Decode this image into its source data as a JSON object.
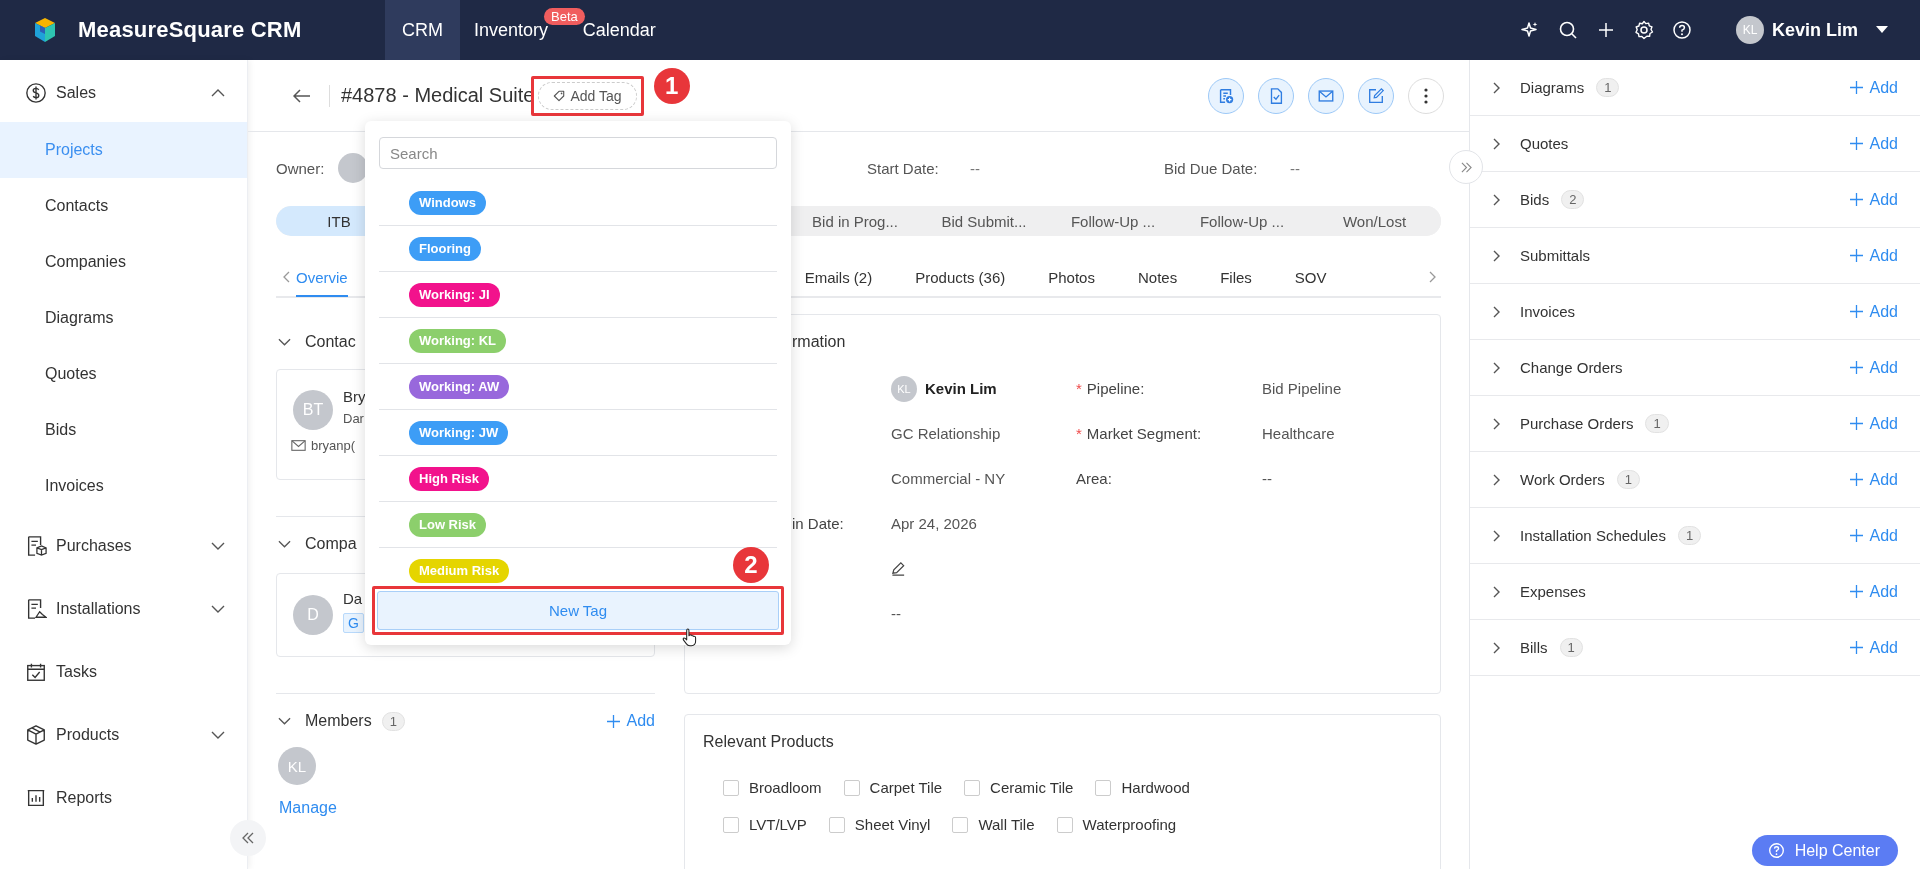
{
  "app": {
    "title": "MeasureSquare CRM"
  },
  "top_nav": [
    {
      "label": "CRM",
      "selected": true
    },
    {
      "label": "Inventory",
      "selected": false,
      "badge": "Beta"
    },
    {
      "label": "Calendar",
      "selected": false
    }
  ],
  "user": {
    "initials": "KL",
    "name": "Kevin Lim"
  },
  "sidebar": {
    "items": [
      {
        "label": "Sales",
        "kind": "group",
        "expanded": true,
        "children": [
          {
            "label": "Projects",
            "selected": true
          },
          {
            "label": "Contacts",
            "selected": false
          },
          {
            "label": "Companies",
            "selected": false
          },
          {
            "label": "Diagrams",
            "selected": false
          },
          {
            "label": "Quotes",
            "selected": false
          },
          {
            "label": "Bids",
            "selected": false
          },
          {
            "label": "Invoices",
            "selected": false
          }
        ]
      },
      {
        "label": "Purchases",
        "kind": "group",
        "expanded": false
      },
      {
        "label": "Installations",
        "kind": "group",
        "expanded": false
      },
      {
        "label": "Tasks",
        "kind": "link"
      },
      {
        "label": "Products",
        "kind": "group",
        "expanded": false
      },
      {
        "label": "Reports",
        "kind": "link"
      }
    ]
  },
  "record": {
    "title": "#4878 - Medical Suite",
    "add_tag": "Add Tag"
  },
  "step_markers": [
    "1",
    "2"
  ],
  "tag_menu": {
    "search_placeholder": "Search",
    "tags": [
      {
        "label": "Windows",
        "color": "#3d9df6"
      },
      {
        "label": "Flooring",
        "color": "#3d9df6"
      },
      {
        "label": "Working: JI",
        "color": "#f2128c"
      },
      {
        "label": "Working: KL",
        "color": "#8ccf6c"
      },
      {
        "label": "Working: AW",
        "color": "#9868dc"
      },
      {
        "label": "Working: JW",
        "color": "#3d9df6"
      },
      {
        "label": "High Risk",
        "color": "#f2128c"
      },
      {
        "label": "Low Risk",
        "color": "#8ccf6c"
      },
      {
        "label": "Medium Risk",
        "color": "#e5d500"
      }
    ],
    "new_tag": "New Tag"
  },
  "summary": {
    "owner_label": "Owner:",
    "start_date_label": "Start Date:",
    "start_date": "--",
    "bid_due_label": "Bid Due Date:",
    "bid_due": "--"
  },
  "stages": [
    {
      "label": "ITB",
      "selected": true
    },
    {
      "label": "Bid in Prog...",
      "selected": false
    },
    {
      "label": "Bid Submit...",
      "selected": false
    },
    {
      "label": "Follow-Up ...",
      "selected": false
    },
    {
      "label": "Follow-Up ...",
      "selected": false
    },
    {
      "label": "Won/Lost",
      "selected": false
    }
  ],
  "tabs": [
    {
      "label": "Overvie",
      "selected": true
    },
    {
      "label": "Emails (2)",
      "selected": false
    },
    {
      "label": "Products (36)",
      "selected": false
    },
    {
      "label": "Photos",
      "selected": false
    },
    {
      "label": "Notes",
      "selected": false
    },
    {
      "label": "Files",
      "selected": false
    },
    {
      "label": "SOV",
      "selected": false
    }
  ],
  "contacts_section": {
    "title": "Contac",
    "card": {
      "initials": "BT",
      "name": "Bry",
      "subtitle": "Dar",
      "email": "bryanp("
    }
  },
  "company_section": {
    "title": "Compa",
    "card": {
      "initials": "D",
      "name": "Da",
      "tag": "G"
    }
  },
  "members_section": {
    "title": "Members",
    "count": "1",
    "add": "Add",
    "members": [
      "KL"
    ],
    "manage": "Manage"
  },
  "project_info": {
    "title": "rmation",
    "left": [
      {
        "kind": "user",
        "initials": "KL",
        "value": "Kevin Lim"
      },
      {
        "kind": "text",
        "value": "GC Relationship"
      },
      {
        "kind": "text",
        "value": "Commercial - NY"
      },
      {
        "kind": "text",
        "label": "in Date:",
        "value": "Apr 24, 2026"
      },
      {
        "kind": "edit"
      },
      {
        "kind": "text",
        "value": "--"
      }
    ],
    "right": [
      {
        "required_mark": "*",
        "label": "Pipeline:",
        "value": "Bid Pipeline"
      },
      {
        "required_mark": "*",
        "label": "Market Segment:",
        "value": "Healthcare"
      },
      {
        "label": "Area:",
        "value": "--"
      }
    ]
  },
  "relevant_products": {
    "title": "Relevant Products",
    "rows": [
      [
        {
          "label": "Broadloom",
          "checked": false
        },
        {
          "label": "Carpet Tile",
          "checked": false
        },
        {
          "label": "Ceramic Tile",
          "checked": false
        },
        {
          "label": "Hardwood",
          "checked": false
        }
      ],
      [
        {
          "label": "LVT/LVP",
          "checked": false
        },
        {
          "label": "Sheet Vinyl",
          "checked": false
        },
        {
          "label": "Wall Tile",
          "checked": false
        },
        {
          "label": "Waterproofing",
          "checked": false
        }
      ]
    ]
  },
  "side_panel": {
    "sections": [
      {
        "label": "Diagrams",
        "count": "1",
        "add": "Add"
      },
      {
        "label": "Quotes",
        "add": "Add"
      },
      {
        "label": "Bids",
        "count": "2",
        "add": "Add"
      },
      {
        "label": "Submittals",
        "add": "Add"
      },
      {
        "label": "Invoices",
        "add": "Add"
      },
      {
        "label": "Change Orders",
        "add": "Add"
      },
      {
        "label": "Purchase Orders",
        "count": "1",
        "add": "Add"
      },
      {
        "label": "Work Orders",
        "count": "1",
        "add": "Add"
      },
      {
        "label": "Installation Schedules",
        "count": "1",
        "add": "Add"
      },
      {
        "label": "Expenses",
        "add": "Add"
      },
      {
        "label": "Bills",
        "count": "1",
        "add": "Add"
      }
    ]
  },
  "help_button": "Help Center"
}
